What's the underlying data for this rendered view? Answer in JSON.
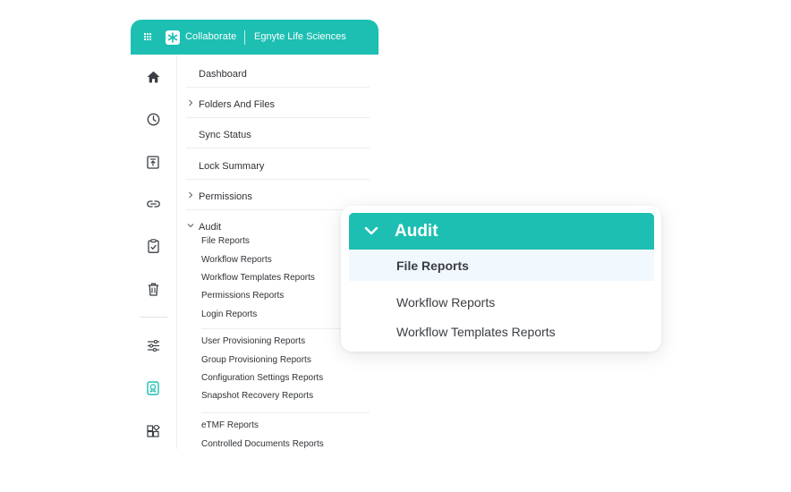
{
  "header": {
    "app_name": "Collaborate",
    "workspace": "Egnyte Life Sciences",
    "color": "#1dbfb2"
  },
  "rail": {
    "icons": [
      "home-icon",
      "clock-icon",
      "upload-icon",
      "link-icon",
      "clipboard-check-icon",
      "trash-icon",
      "sliders-icon",
      "report-badge-icon",
      "apps-grid-icon"
    ],
    "active_icon": "report-badge-icon",
    "active_color": "#1dbfb2"
  },
  "nav": {
    "dashboard": "Dashboard",
    "folders_and_files": "Folders And Files",
    "sync_status": "Sync Status",
    "lock_summary": "Lock Summary",
    "permissions": "Permissions",
    "audit": "Audit",
    "audit_items": [
      "File Reports",
      "Workflow Reports",
      "Workflow Templates Reports",
      "Permissions Reports",
      "Login Reports",
      "User Provisioning Reports",
      "Group Provisioning Reports",
      "Configuration Settings Reports",
      "Snapshot Recovery Reports",
      "eTMF Reports",
      "Controlled Documents Reports"
    ]
  },
  "popup": {
    "title": "Audit",
    "items": [
      "File Reports",
      "Workflow Reports",
      "Workflow Templates Reports"
    ],
    "selected": "File Reports",
    "highlight_color": "#f1f8fe"
  }
}
